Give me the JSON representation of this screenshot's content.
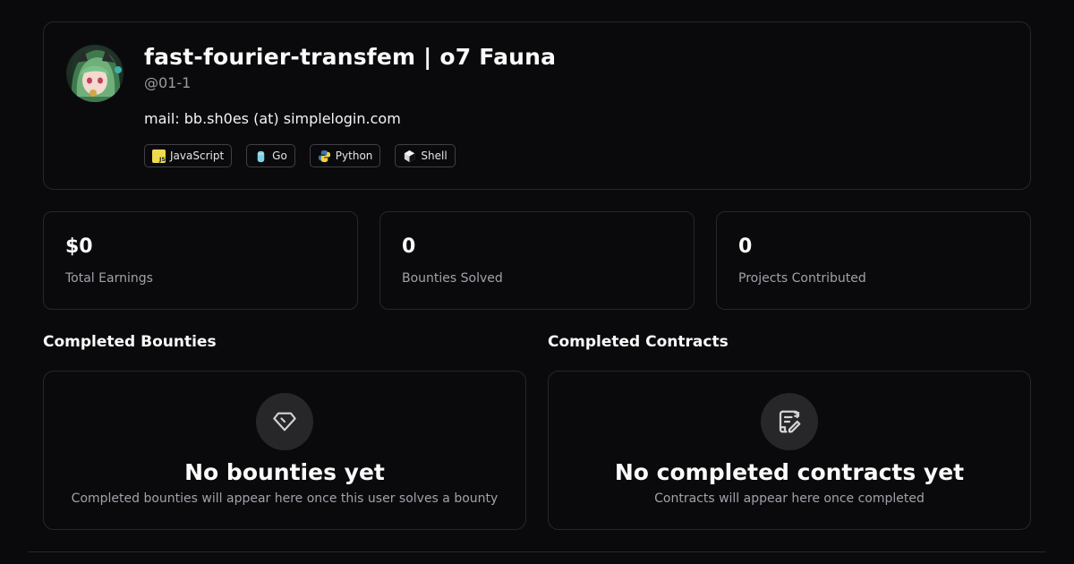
{
  "profile": {
    "name": "fast-fourier-transfem | o7 Fauna",
    "handle": "@01-1",
    "bio": "mail: bb.sh0es (at) simplelogin.com",
    "languages": [
      {
        "label": "JavaScript",
        "icon": "javascript-icon"
      },
      {
        "label": "Go",
        "icon": "go-icon"
      },
      {
        "label": "Python",
        "icon": "python-icon"
      },
      {
        "label": "Shell",
        "icon": "shell-icon"
      }
    ]
  },
  "stats": [
    {
      "value": "$0",
      "label": "Total Earnings"
    },
    {
      "value": "0",
      "label": "Bounties Solved"
    },
    {
      "value": "0",
      "label": "Projects Contributed"
    }
  ],
  "bounties": {
    "title": "Completed Bounties",
    "empty_title": "No bounties yet",
    "empty_desc": "Completed bounties will appear here once this user solves a bounty",
    "icon": "gem-icon"
  },
  "contracts": {
    "title": "Completed Contracts",
    "empty_title": "No completed contracts yet",
    "empty_desc": "Contracts will appear here once completed",
    "icon": "scroll-icon"
  },
  "colors": {
    "background": "#0a0a0c",
    "border": "#27272a",
    "muted_text": "#a1a1aa"
  }
}
